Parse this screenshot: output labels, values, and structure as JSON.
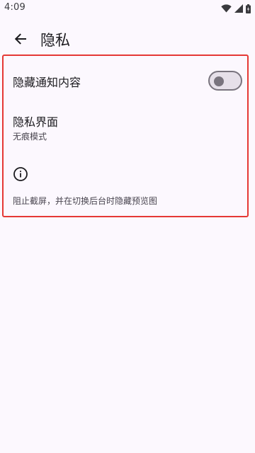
{
  "status_bar": {
    "time": "4:09",
    "icons": [
      "wifi-icon",
      "signal-icon",
      "battery-icon"
    ]
  },
  "app_bar": {
    "back_icon": "arrow-back-icon",
    "title": "隐私"
  },
  "settings": {
    "hide_notification_content": {
      "label": "隐藏通知内容",
      "toggle_on": false
    },
    "private_ui": {
      "label": "隐私界面",
      "subtitle": "无痕模式"
    },
    "info": {
      "icon": "info-icon",
      "text": "阻止截屏，并在切换后台时隐藏预览图"
    }
  },
  "colors": {
    "background": "#fcf8fe",
    "highlight_border": "#e53935",
    "toggle_track_off": "#e6e0e9",
    "toggle_outline": "#79747e"
  }
}
